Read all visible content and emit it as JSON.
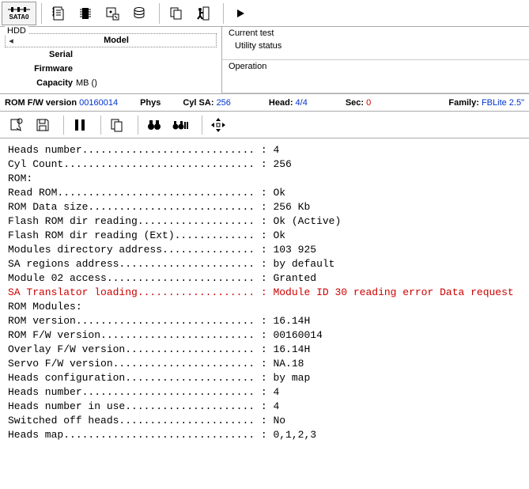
{
  "topbar": {
    "port_label": "SATA0"
  },
  "hdd": {
    "group_label": "HDD",
    "model_label": "Model",
    "serial_label": "Serial",
    "firmware_label": "Firmware",
    "capacity_label": "Capacity",
    "capacity_value": "MB ()"
  },
  "right": {
    "current_test_label": "Current test",
    "utility_status_label": "Utility status",
    "operation_label": "Operation"
  },
  "status": {
    "rom_fw_label": "ROM F/W version",
    "rom_fw_value": "00160014",
    "phys_label": "Phys",
    "cyl_sa_label": "Cyl SA:",
    "cyl_sa_value": "256",
    "head_label": "Head:",
    "head_value": "4/4",
    "sec_label": "Sec:",
    "sec_value": "0",
    "family_label": "Family:",
    "family_value": "FBLite 2.5\""
  },
  "log": [
    {
      "t": "Heads number............................ : 4"
    },
    {
      "t": "Cyl Count............................... : 256"
    },
    {
      "t": ""
    },
    {
      "t": "ROM:"
    },
    {
      "t": "Read ROM................................ : Ok"
    },
    {
      "t": "ROM Data size........................... : 256 Kb"
    },
    {
      "t": "Flash ROM dir reading................... : Ok (Active)"
    },
    {
      "t": "Flash ROM dir reading (Ext)............. : Ok"
    },
    {
      "t": "Modules directory address............... : 103 925"
    },
    {
      "t": "SA regions address...................... : by default"
    },
    {
      "t": "Module 02 access........................ : Granted"
    },
    {
      "t": "SA Translator loading................... : Module ID 30 reading error Data request",
      "err": true
    },
    {
      "t": ""
    },
    {
      "t": "ROM Modules:"
    },
    {
      "t": "ROM version............................. : 16.14H"
    },
    {
      "t": "ROM F/W version......................... : 00160014"
    },
    {
      "t": "Overlay F/W version..................... : 16.14H"
    },
    {
      "t": "Servo F/W version....................... : NA.18"
    },
    {
      "t": ""
    },
    {
      "t": "Heads configuration..................... : by map"
    },
    {
      "t": "Heads number............................ : 4"
    },
    {
      "t": "Heads number in use..................... : 4"
    },
    {
      "t": "Switched off heads...................... : No"
    },
    {
      "t": "Heads map............................... : 0,1,2,3"
    }
  ]
}
